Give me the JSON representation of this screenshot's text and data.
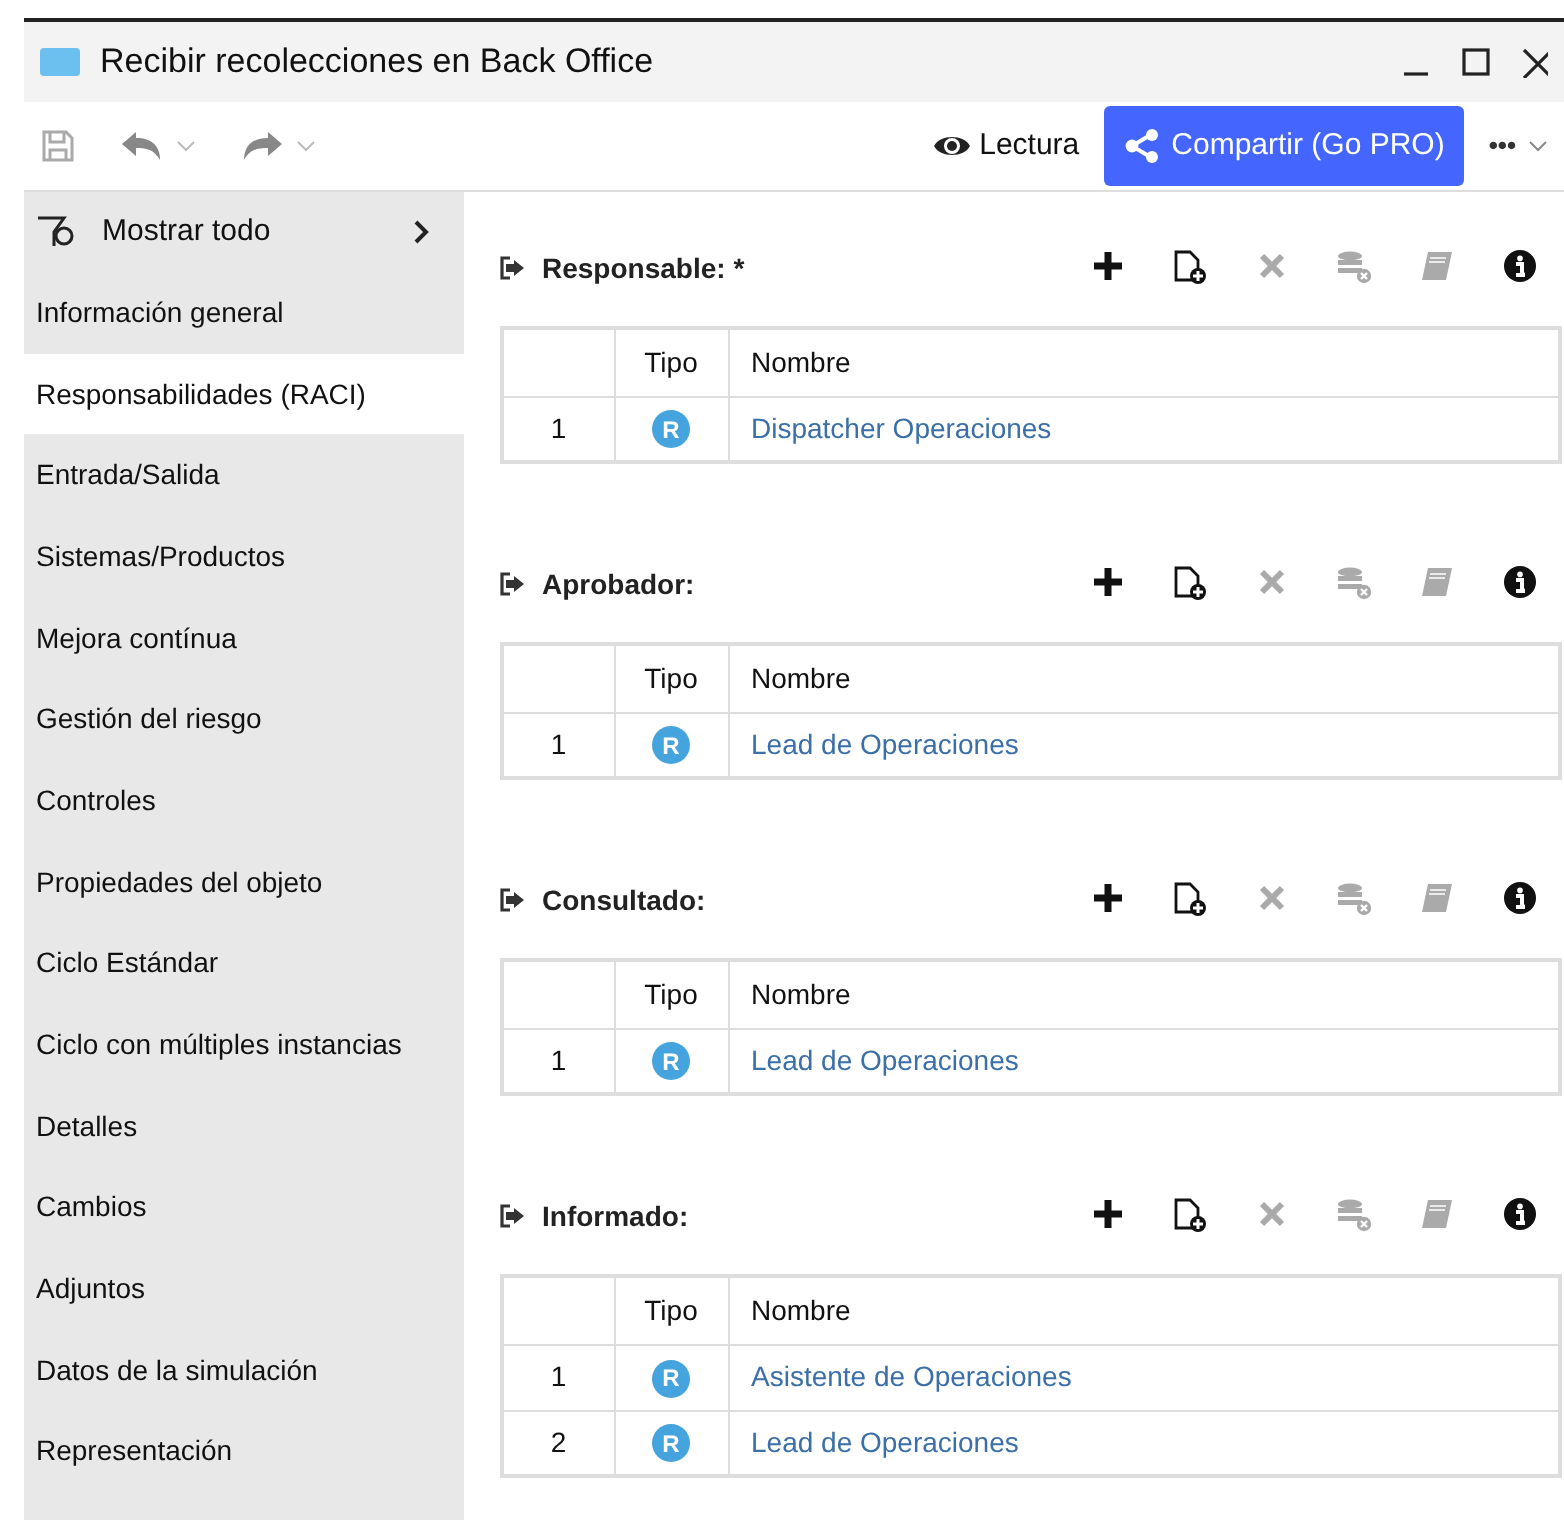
{
  "window": {
    "title": "Recibir recolecciones en Back Office"
  },
  "toolbar": {
    "read_mode": "Lectura",
    "share": "Compartir (Go PRO)",
    "more": "•••"
  },
  "sidebar": {
    "filter": "Mostrar todo",
    "items": [
      {
        "label": "Información general",
        "selected": false
      },
      {
        "label": "Responsabilidades (RACI)",
        "selected": true
      },
      {
        "label": "Entrada/Salida",
        "selected": false
      },
      {
        "label": "Sistemas/Productos",
        "selected": false
      },
      {
        "label": "Mejora contínua",
        "selected": false
      },
      {
        "label": "Gestión del riesgo",
        "selected": false
      },
      {
        "label": "Controles",
        "selected": false
      },
      {
        "label": "Propiedades del objeto",
        "selected": false
      },
      {
        "label": "Ciclo Estándar",
        "selected": false
      },
      {
        "label": "Ciclo con múltiples instancias",
        "selected": false
      },
      {
        "label": "Detalles",
        "selected": false
      },
      {
        "label": "Cambios",
        "selected": false
      },
      {
        "label": "Adjuntos",
        "selected": false
      },
      {
        "label": "Datos de la simulación",
        "selected": false
      },
      {
        "label": "Representación",
        "selected": false
      }
    ]
  },
  "sections": [
    {
      "title": "Responsable: *",
      "columns": [
        "Tipo",
        "Nombre"
      ],
      "rows": [
        {
          "number": "1",
          "type": "R",
          "name": "Dispatcher Operaciones"
        }
      ],
      "actions": [
        {
          "kind": "add",
          "disabled": false
        },
        {
          "kind": "new",
          "disabled": false
        },
        {
          "kind": "remove",
          "disabled": true
        },
        {
          "kind": "db",
          "disabled": true
        },
        {
          "kind": "book",
          "disabled": true
        },
        {
          "kind": "info",
          "disabled": false
        }
      ]
    },
    {
      "title": "Aprobador:",
      "columns": [
        "Tipo",
        "Nombre"
      ],
      "rows": [
        {
          "number": "1",
          "type": "R",
          "name": "Lead de Operaciones"
        }
      ],
      "actions": [
        {
          "kind": "add",
          "disabled": false
        },
        {
          "kind": "new",
          "disabled": false
        },
        {
          "kind": "remove",
          "disabled": true
        },
        {
          "kind": "db",
          "disabled": true
        },
        {
          "kind": "book",
          "disabled": true
        },
        {
          "kind": "info",
          "disabled": false
        }
      ]
    },
    {
      "title": "Consultado:",
      "columns": [
        "Tipo",
        "Nombre"
      ],
      "rows": [
        {
          "number": "1",
          "type": "R",
          "name": "Lead de Operaciones"
        }
      ],
      "actions": [
        {
          "kind": "add",
          "disabled": false
        },
        {
          "kind": "new",
          "disabled": false
        },
        {
          "kind": "remove",
          "disabled": true
        },
        {
          "kind": "db",
          "disabled": true
        },
        {
          "kind": "book",
          "disabled": true
        },
        {
          "kind": "info",
          "disabled": false
        }
      ]
    },
    {
      "title": "Informado:",
      "columns": [
        "Tipo",
        "Nombre"
      ],
      "rows": [
        {
          "number": "1",
          "type": "R",
          "name": "Asistente de Operaciones"
        },
        {
          "number": "2",
          "type": "R",
          "name": "Lead de Operaciones"
        }
      ],
      "actions": [
        {
          "kind": "add",
          "disabled": false
        },
        {
          "kind": "new",
          "disabled": false
        },
        {
          "kind": "remove",
          "disabled": true
        },
        {
          "kind": "db",
          "disabled": true
        },
        {
          "kind": "book",
          "disabled": true
        },
        {
          "kind": "info",
          "disabled": false
        }
      ]
    }
  ]
}
